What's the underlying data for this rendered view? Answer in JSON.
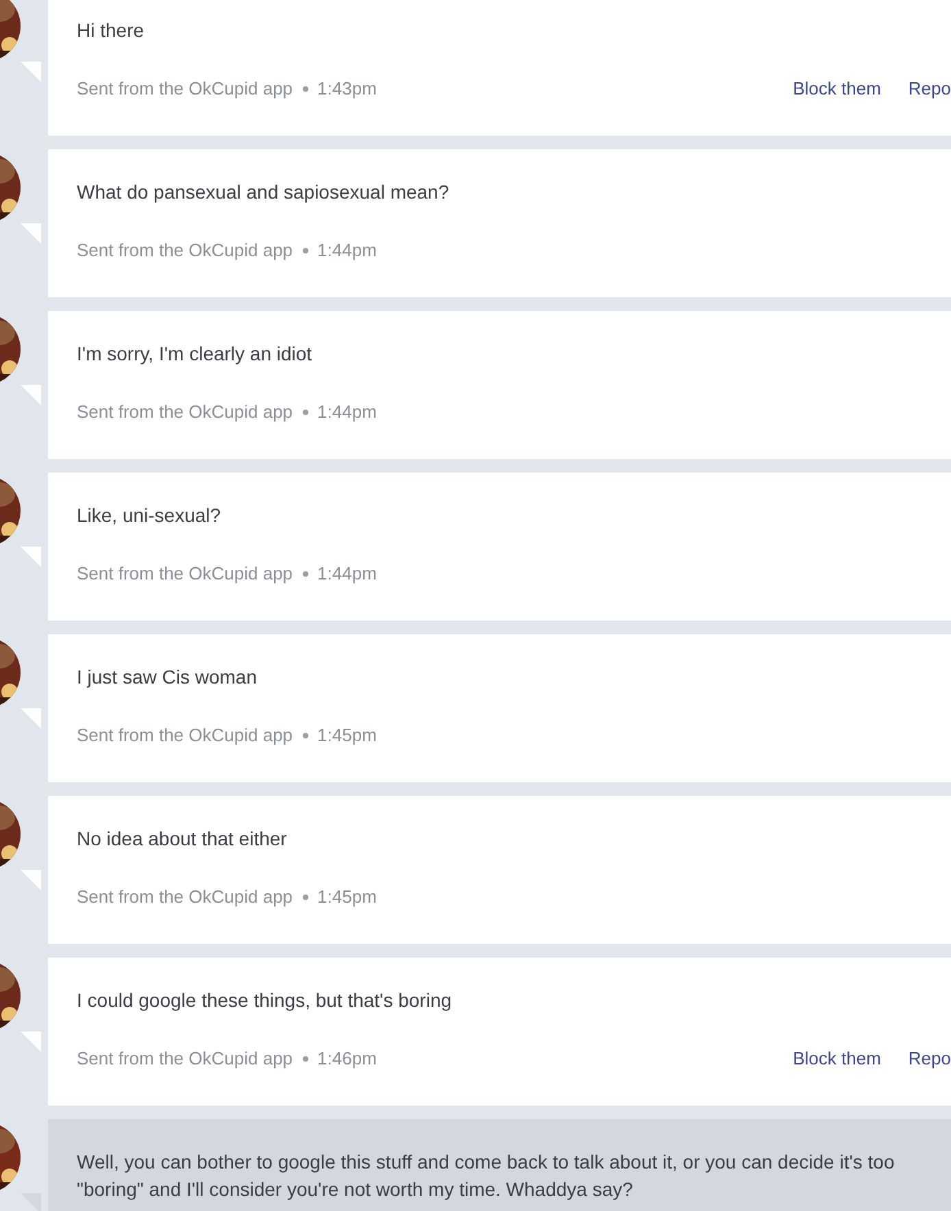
{
  "messages": [
    {
      "kind": "received",
      "text": "Hi there",
      "source": "Sent from the OkCupid app",
      "time": "1:43pm",
      "actions": [
        "Block them",
        "Repo"
      ]
    },
    {
      "kind": "received",
      "text": "What do pansexual and sapiosexual mean?",
      "source": "Sent from the OkCupid app",
      "time": "1:44pm"
    },
    {
      "kind": "received",
      "text": "I'm sorry, I'm clearly an idiot",
      "source": "Sent from the OkCupid app",
      "time": "1:44pm"
    },
    {
      "kind": "received",
      "text": "Like, uni-sexual?",
      "source": "Sent from the OkCupid app",
      "time": "1:44pm"
    },
    {
      "kind": "received",
      "text": "I just saw Cis woman",
      "source": "Sent from the OkCupid app",
      "time": "1:45pm"
    },
    {
      "kind": "received",
      "text": "No idea about that either",
      "source": "Sent from the OkCupid app",
      "time": "1:45pm"
    },
    {
      "kind": "received",
      "text": "I could google these things, but that's boring",
      "source": "Sent from the OkCupid app",
      "time": "1:46pm",
      "actions": [
        "Block them",
        "Repo"
      ]
    },
    {
      "kind": "sent",
      "text": "Well, you can bother to google this stuff and come back to talk about it, or you can decide it's too \"boring\" and I'll consider you're not worth my time. Whaddya say?"
    }
  ]
}
